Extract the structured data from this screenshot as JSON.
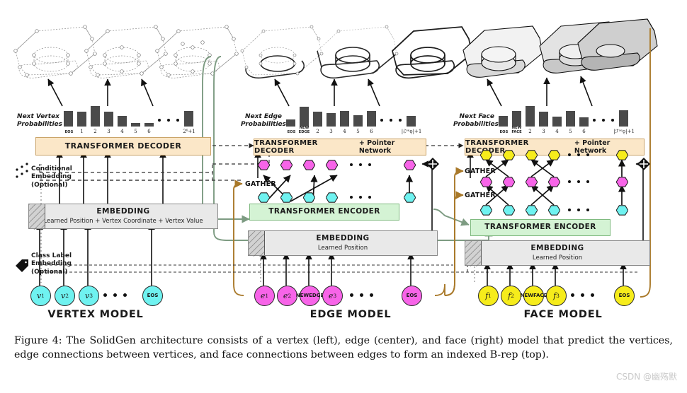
{
  "figure": {
    "caption": "Figure 4: The SolidGen architecture consists of a vertex (left), edge (center), and face (right) model that predict the vertices, edge connections between vertices, and face connections between edges to form an indexed B-rep (top).",
    "watermark": "CSDN @幽殇默"
  },
  "colors": {
    "decoder_fill": "#fbe7c8",
    "encoder_fill": "#d4f3d4",
    "embedding_fill": "#e9e9e9",
    "vertex_token": "#6ff2f0",
    "edge_token": "#f764e8",
    "face_token": "#f6ec1b",
    "gather_arrow": "#a9792a",
    "flow_line": "#7d9b82",
    "bar": "#4a4a4a"
  },
  "models": [
    {
      "id": "vertex",
      "name": "VERTEX MODEL",
      "prob_label_line1": "Next Vertex",
      "prob_label_line2": "Probabilities",
      "decoder_label": "TRANSFORMER DECODER",
      "decoder_suffix": "",
      "embedding_title": "EMBEDDING",
      "embedding_subtitle": "Learned Position + Vertex Coordinate + Vertex Value",
      "has_encoder": false,
      "encoder_label": "",
      "tokens": [
        "v1",
        "v2",
        "v3",
        "EOS"
      ],
      "annotations": [
        {
          "line1": "Conditional",
          "line2": "Embedding",
          "line3": "(Optional)"
        },
        {
          "line1": "Class Label",
          "line2": "Embedding",
          "line3": "(Optional)"
        }
      ],
      "bar_chart": {
        "type": "bar",
        "title": "Next Vertex Probabilities",
        "categories": [
          "EOS",
          "1",
          "2",
          "3",
          "4",
          "5",
          "6",
          "2^q+1"
        ],
        "values": [
          22,
          21,
          29,
          21,
          15,
          5,
          5,
          22
        ],
        "ylim": [
          0,
          32
        ]
      }
    },
    {
      "id": "edge",
      "name": "EDGE MODEL",
      "prob_label_line1": "Next Edge",
      "prob_label_line2": "Probabilities",
      "decoder_label": "TRANSFORMER DECODER",
      "decoder_suffix": "+ Pointer Network",
      "embedding_title": "EMBEDDING",
      "embedding_subtitle": "Learned Position",
      "has_encoder": true,
      "encoder_label": "TRANSFORMER ENCODER",
      "gather_label": "GATHER",
      "tokens": [
        "e1",
        "e2",
        "NEW EDGE",
        "e3",
        "EOS"
      ],
      "annotations": [],
      "bar_chart": {
        "type": "bar",
        "title": "Next Edge Probabilities",
        "categories": [
          "EOS",
          "NEW EDGE",
          "2",
          "3",
          "4",
          "5",
          "6",
          "|E^seq|+1"
        ],
        "values": [
          10,
          28,
          21,
          19,
          22,
          16,
          22,
          15
        ],
        "ylim": [
          0,
          32
        ]
      }
    },
    {
      "id": "face",
      "name": "FACE MODEL",
      "prob_label_line1": "Next Face",
      "prob_label_line2": "Probabilities",
      "decoder_label": "TRANSFORMER DECODER",
      "decoder_suffix": "+ Pointer Network",
      "embedding_title": "EMBEDDING",
      "embedding_subtitle": "Learned Position",
      "has_encoder": true,
      "encoder_label": "TRANSFORMER ENCODER",
      "gather_label": "GATHER",
      "tokens": [
        "f1",
        "f2",
        "NEW FACE",
        "f3",
        "EOS"
      ],
      "annotations": [],
      "bar_chart": {
        "type": "bar",
        "title": "Next Face Probabilities",
        "categories": [
          "EOS",
          "NEW FACE",
          "2",
          "3",
          "4",
          "5",
          "6",
          "|F^seq|+1"
        ],
        "values": [
          15,
          22,
          29,
          21,
          14,
          22,
          13,
          23
        ],
        "ylim": [
          0,
          32
        ]
      }
    }
  ],
  "tokens": {
    "v1": {
      "base": "v",
      "sub": "1"
    },
    "v2": {
      "base": "v",
      "sub": "2"
    },
    "v3": {
      "base": "v",
      "sub": "3"
    },
    "e1": {
      "base": "e",
      "sub": "1"
    },
    "e2": {
      "base": "e",
      "sub": "2"
    },
    "e3": {
      "base": "e",
      "sub": "3"
    },
    "f1": {
      "base": "f",
      "sub": "1"
    },
    "f2": {
      "base": "f",
      "sub": "2"
    },
    "f3": {
      "base": "f",
      "sub": "3"
    },
    "eos": "EOS",
    "new_edge_l1": "NEW",
    "new_edge_l2": "EDGE",
    "new_face_l1": "NEW",
    "new_face_l2": "FACE"
  },
  "bar_ticks": {
    "vertex": [
      "EOS",
      "1",
      "2",
      "3",
      "4",
      "5",
      "6",
      "2ᵟ+1"
    ],
    "edge_last": "|ℰˢᵉǫ|+1",
    "face_last": "|ℱˢᵉǫ|+1",
    "mid": [
      "2",
      "3",
      "4",
      "5",
      "6"
    ]
  }
}
